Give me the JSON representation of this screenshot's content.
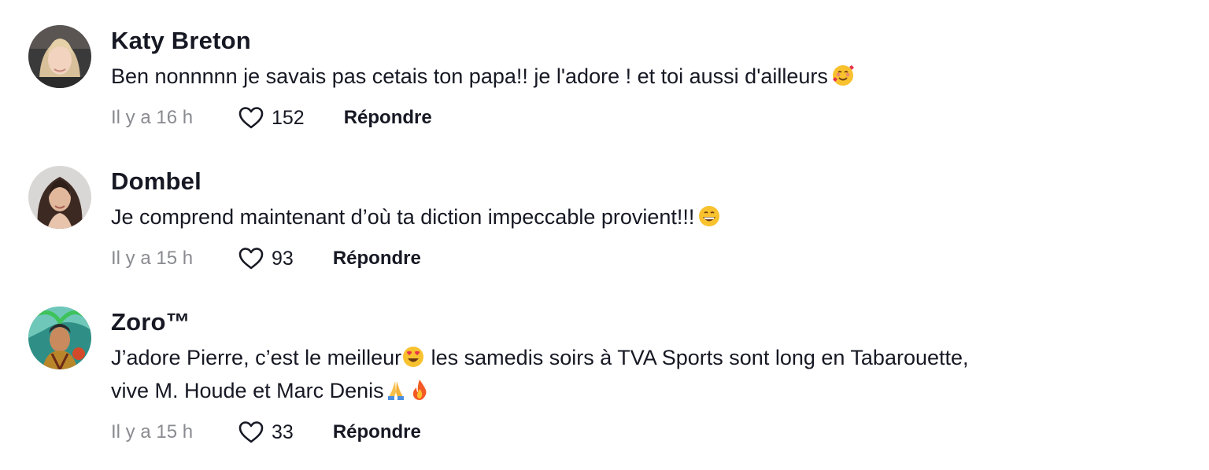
{
  "comments": [
    {
      "username": "Katy Breton",
      "text": "Ben nonnnnn je savais pas cetais ton papa!! je l'adore ! et toi aussi d'ailleurs",
      "emoji": "smiling-face-with-hearts",
      "time": "Il y a 16 h",
      "likes": "152",
      "reply_label": "Répondre",
      "avatar_icon": "avatar-blonde-woman"
    },
    {
      "username": "Dombel",
      "text": "Je comprend maintenant d’où ta diction impeccable provient!!!",
      "emoji": "grinning-face",
      "time": "Il y a 15 h",
      "likes": "93",
      "reply_label": "Répondre",
      "avatar_icon": "avatar-brunette-woman"
    },
    {
      "username": "Zoro™",
      "text_line1_a": "J’adore Pierre, c’est le meilleur",
      "text_line1_b": " les samedis soirs à TVA Sports sont long en Tabarouette,",
      "text_line2": "vive M. Houde et Marc Denis",
      "emojis": [
        "heart-eyes",
        "folded-hands",
        "fire"
      ],
      "time": "Il y a 15 h",
      "likes": "33",
      "reply_label": "Répondre",
      "avatar_icon": "avatar-anime-character"
    }
  ],
  "colors": {
    "text": "#161823",
    "muted": "#8a8b91"
  }
}
